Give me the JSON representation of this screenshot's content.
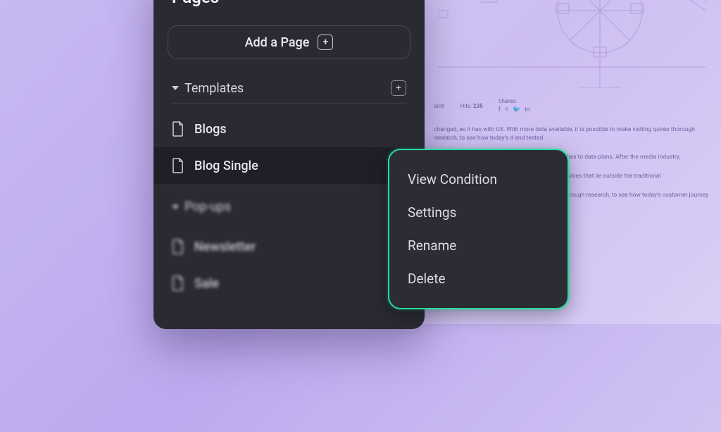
{
  "panel": {
    "title": "Pages",
    "add_button_label": "Add a Page"
  },
  "sections": {
    "templates": {
      "label": "Templates",
      "items": [
        {
          "label": "Blogs",
          "active": false
        },
        {
          "label": "Blog Single",
          "active": true
        }
      ]
    },
    "popups": {
      "label": "Pop-ups",
      "items": [
        {
          "label": "Newsletter"
        },
        {
          "label": "Sale"
        }
      ]
    }
  },
  "context_menu": {
    "items": [
      "View Condition",
      "Settings",
      "Rename",
      "Delete"
    ]
  },
  "bg_article": {
    "cat_label": "arch",
    "hits_label": "Hits:",
    "hits_value": "235",
    "shares_label": "Shares:",
    "p1": "changed, as it has with UX. With more data available, it is possible to make visiting quires thorough research, to see how today's d and tested.",
    "p2": "ation, have changed mobile network operators' m, ties to data plans. After the media industry,",
    "p3": "digitising mobile network operators' services al services that lie outside the traditional",
    "p4": "s available, it is possible to make visiting quires thorough research, to see how today's customer journey and achieve the desired and tested."
  }
}
